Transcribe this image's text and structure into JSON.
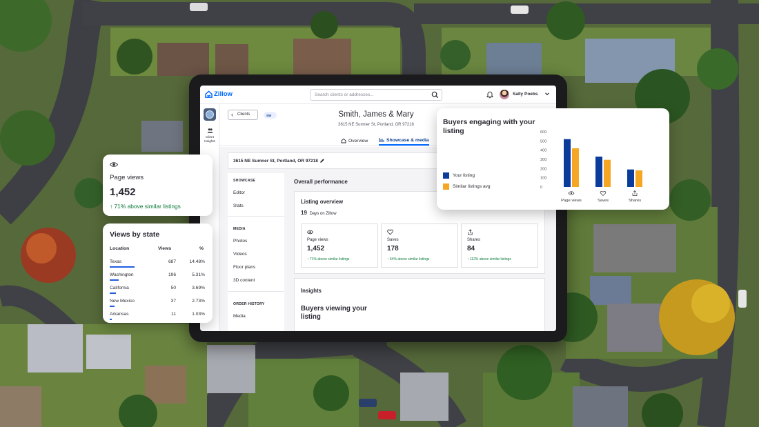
{
  "app": {
    "logo_text": "Zillow"
  },
  "header": {
    "search_placeholder": "Search clients or addresses...",
    "user_name": "Sally Poebs"
  },
  "rail": {
    "item_label": "Client Insights"
  },
  "client": {
    "back_label": "Clients",
    "badge": "SW",
    "name": "Smith, James & Mary",
    "address": "3615 NE Sumner St, Portland, OR 97218"
  },
  "tabs": [
    {
      "label": "Overview"
    },
    {
      "label": "Showcase & media"
    }
  ],
  "listing_address": "3615 NE Sumner St, Portland, OR 97218",
  "sidenav": {
    "showcase_header": "SHOWCASE",
    "showcase_items": [
      "Editor",
      "Stats"
    ],
    "media_header": "MEDIA",
    "media_items": [
      "Photos",
      "Videos",
      "Floor plans",
      "3D content"
    ],
    "order_header": "ORDER HISTORY",
    "order_items": [
      "Media"
    ]
  },
  "overall": {
    "title": "Overall performance",
    "card_title": "Listing overview",
    "days_value": "19",
    "days_label": "Days on Zillow",
    "metrics": [
      {
        "label": "Page views",
        "value": "1,452",
        "trend": "↑ 71% above similar listings",
        "icon": "eye-icon"
      },
      {
        "label": "Saves",
        "value": "178",
        "trend": "↑ 54% above similar listings",
        "icon": "heart-icon"
      },
      {
        "label": "Shares",
        "value": "84",
        "trend": "↑ 112% above similar listings",
        "icon": "share-icon"
      }
    ]
  },
  "insights": {
    "title": "Insights",
    "subtitle": "Buyers viewing your listing"
  },
  "page_views_card": {
    "label": "Page views",
    "value": "1,452",
    "trend": "↑ 71% above similar listings"
  },
  "views_by_state": {
    "title": "Views by state",
    "headers": [
      "Location",
      "Views",
      "%"
    ],
    "rows": [
      {
        "location": "Texas",
        "views": "687",
        "pct": "14.48%",
        "share": 0.1448
      },
      {
        "location": "Washington",
        "views": "196",
        "pct": "5.31%",
        "share": 0.0531
      },
      {
        "location": "California",
        "views": "50",
        "pct": "3.69%",
        "share": 0.0369
      },
      {
        "location": "New Mexico",
        "views": "37",
        "pct": "2.73%",
        "share": 0.0273
      },
      {
        "location": "Arkansas",
        "views": "11",
        "pct": "1.03%",
        "share": 0.0103
      }
    ]
  },
  "colors": {
    "brand": "#006aff",
    "series_your_listing": "#0b3c9c",
    "series_similar": "#f5a623",
    "trend_green": "#0a7a3a"
  },
  "chart_data": {
    "type": "bar",
    "title": "Buyers engaging with your listing",
    "categories": [
      "Page views",
      "Saves",
      "Shares"
    ],
    "category_icons": [
      "eye-icon",
      "heart-icon",
      "share-icon"
    ],
    "series": [
      {
        "name": "Your listing",
        "values": [
          520,
          330,
          190
        ]
      },
      {
        "name": "Similar listings avg",
        "values": [
          420,
          295,
          180
        ]
      }
    ],
    "yticks": [
      0,
      100,
      200,
      300,
      400,
      500,
      600
    ],
    "ylim": [
      0,
      600
    ],
    "grid": false,
    "legend": "left"
  }
}
